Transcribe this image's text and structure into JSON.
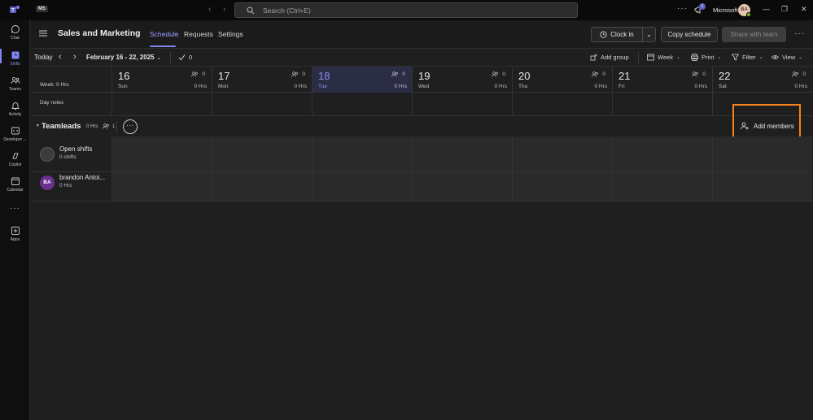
{
  "titlebar": {
    "org_badge": "MS",
    "search_placeholder": "Search (Ctrl+E)",
    "notification_count": "1",
    "org_name": "Microsoft",
    "user_initials": "BA"
  },
  "rail": {
    "items": [
      {
        "label": "Chat",
        "icon": "chat-icon"
      },
      {
        "label": "Shifts",
        "icon": "shifts-icon"
      },
      {
        "label": "Teams",
        "icon": "teams-icon"
      },
      {
        "label": "Activity",
        "icon": "bell-icon"
      },
      {
        "label": "Developer ...",
        "icon": "developer-icon"
      },
      {
        "label": "Copilot",
        "icon": "copilot-icon"
      },
      {
        "label": "Calendar",
        "icon": "calendar-icon"
      },
      {
        "label": "Apps",
        "icon": "apps-icon"
      }
    ]
  },
  "header": {
    "title": "Sales and Marketing",
    "tabs": [
      {
        "label": "Schedule"
      },
      {
        "label": "Requests"
      },
      {
        "label": "Settings"
      }
    ],
    "clock_in": "Clock in",
    "copy_schedule": "Copy schedule",
    "share": "Share with team"
  },
  "toolbar": {
    "today": "Today",
    "date_range": "February 16 - 22, 2025",
    "check_count": "0",
    "add_group": "Add group",
    "week": "Week",
    "print": "Print",
    "filter": "Filter",
    "view": "View"
  },
  "schedule": {
    "week_label": "Week: 0 Hrs",
    "day_notes": "Day notes",
    "days": [
      {
        "num": "16",
        "name": "Sun",
        "count": "0",
        "hrs": "0 Hrs"
      },
      {
        "num": "17",
        "name": "Mon",
        "count": "0",
        "hrs": "0 Hrs"
      },
      {
        "num": "18",
        "name": "Tue",
        "count": "0",
        "hrs": "0 Hrs"
      },
      {
        "num": "19",
        "name": "Wed",
        "count": "0",
        "hrs": "0 Hrs"
      },
      {
        "num": "20",
        "name": "Thu",
        "count": "0",
        "hrs": "0 Hrs"
      },
      {
        "num": "21",
        "name": "Fri",
        "count": "0",
        "hrs": "0 Hrs"
      },
      {
        "num": "22",
        "name": "Sat",
        "count": "0",
        "hrs": "0 Hrs"
      }
    ],
    "group": {
      "name": "Teamleads",
      "hrs": "0 Hrs",
      "members": "1",
      "add_members": "Add members"
    },
    "rows": [
      {
        "name": "Open shifts",
        "sub": "0 shifts"
      },
      {
        "name": "brandon Antoi...",
        "sub": "0 Hrs",
        "initials": "BA"
      }
    ]
  },
  "colors": {
    "accent": "#7f85f5",
    "highlight": "#f7821b",
    "today_bg": "#2b2d45"
  }
}
